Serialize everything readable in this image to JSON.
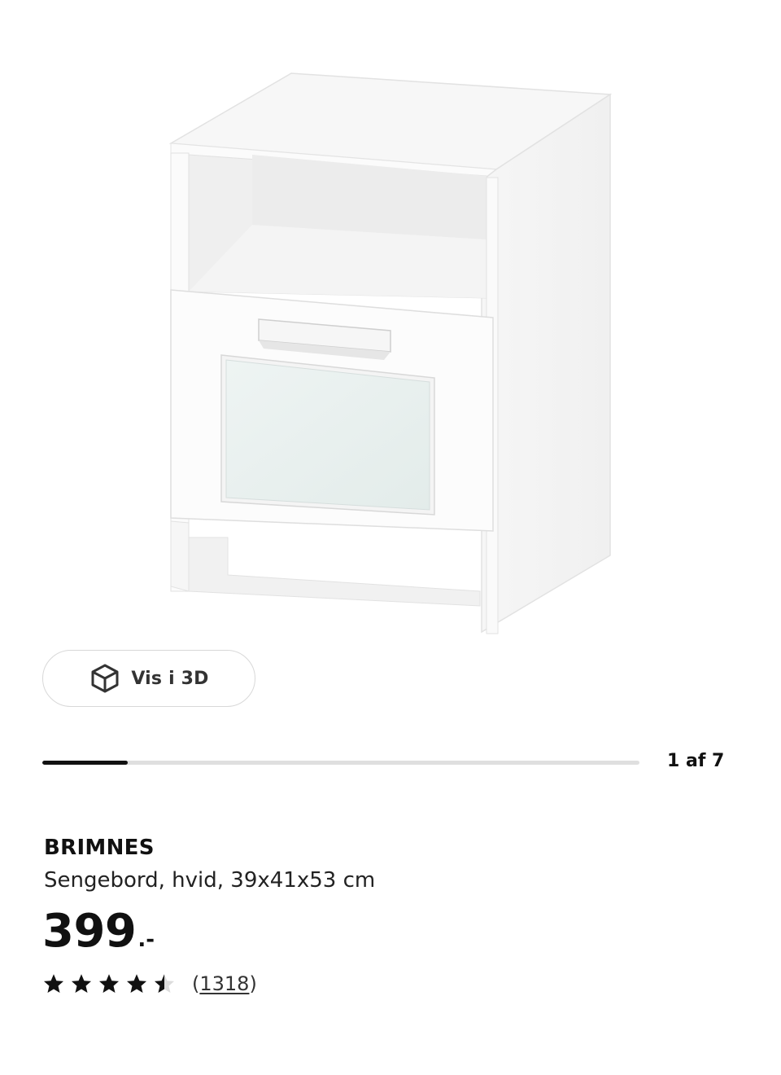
{
  "gallery": {
    "view_3d_label": "Vis i 3D",
    "current_image": 1,
    "total_images": 7,
    "counter_text": "1 af 7",
    "progress_fraction": 0.143
  },
  "product": {
    "name": "BRIMNES",
    "description": "Sengebord, hvid, 39x41x53 cm",
    "price_integer": "399",
    "price_suffix": ".-"
  },
  "rating": {
    "stars": 4.5,
    "max_stars": 5,
    "review_count": "1318"
  },
  "icons": {
    "view_3d": "cube-outline-icon",
    "star": "star-icon"
  },
  "colors": {
    "text": "#111111",
    "border": "#d8d8d8",
    "progress_track": "#dfdfdf",
    "progress_fill": "#111111"
  }
}
